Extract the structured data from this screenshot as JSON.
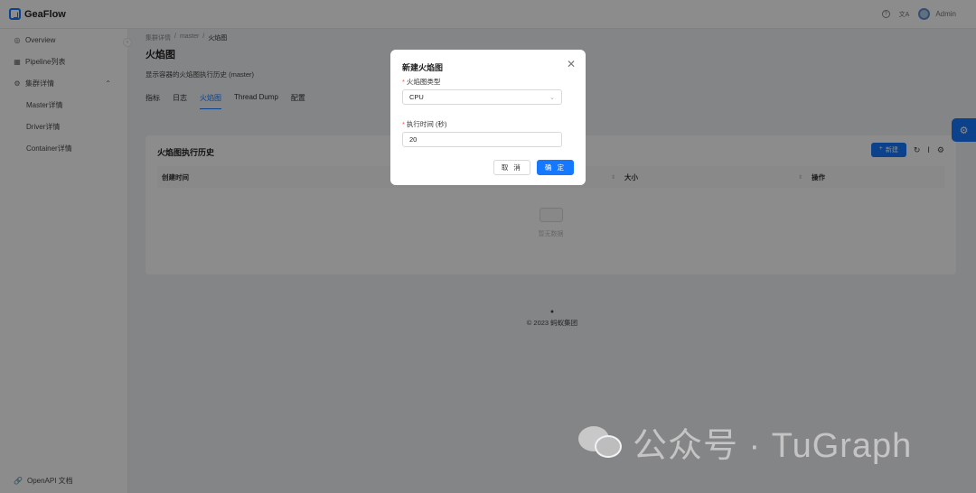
{
  "app": {
    "name": "GeaFlow"
  },
  "topbar": {
    "help_icon": "?",
    "lang_icon": "文A",
    "user_name": "Admin"
  },
  "sidebar": {
    "items": [
      {
        "label": "Overview"
      },
      {
        "label": "Pipeline列表"
      },
      {
        "label": "集群详情"
      }
    ],
    "sub_items": [
      {
        "label": "Master详情"
      },
      {
        "label": "Driver详情"
      },
      {
        "label": "Container详情"
      }
    ],
    "footer_label": "OpenAPI 文档"
  },
  "breadcrumb": {
    "items": [
      "集群详情",
      "master",
      "火焰图"
    ],
    "separator": "/"
  },
  "page": {
    "title": "火焰图",
    "description": "显示容器的火焰图执行历史 (master)"
  },
  "tabs": [
    "指标",
    "日志",
    "火焰图",
    "Thread Dump",
    "配置"
  ],
  "card": {
    "title": "火焰图执行历史",
    "new_button": "新建",
    "columns": [
      "创建时间",
      "大小",
      "操作"
    ],
    "empty_text": "暂无数据"
  },
  "footer": {
    "copyright": "© 2023 蚂蚁集团"
  },
  "watermark": {
    "text": "公众号 · TuGraph"
  },
  "modal": {
    "title": "新建火焰图",
    "type_label": "火焰图类型",
    "type_value": "CPU",
    "duration_label": "执行时间 (秒)",
    "duration_value": "20",
    "cancel": "取 消",
    "ok": "确 定"
  },
  "colors": {
    "primary": "#1677ff",
    "required": "#ff4d4f"
  }
}
